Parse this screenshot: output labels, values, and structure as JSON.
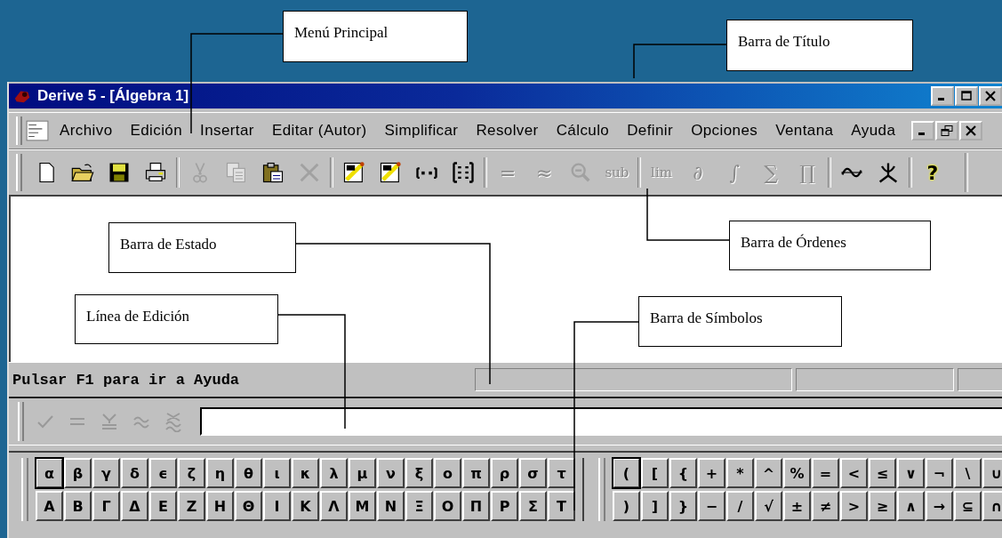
{
  "callouts": [
    {
      "text": "Menú Principal"
    },
    {
      "text": "Barra de Título"
    },
    {
      "text": "Barra de Estado"
    },
    {
      "text": "Barra de Órdenes"
    },
    {
      "text": "Línea de Edición"
    },
    {
      "text": "Barra de Símbolos"
    }
  ],
  "window": {
    "title": "Derive 5 - [Álgebra 1]"
  },
  "menu": [
    "Archivo",
    "Edición",
    "Insertar",
    "Editar (Autor)",
    "Simplificar",
    "Resolver",
    "Cálculo",
    "Definir",
    "Opciones",
    "Ventana",
    "Ayuda"
  ],
  "toolbar": [
    [
      {
        "kind": "page",
        "disabled": false
      },
      {
        "kind": "folder",
        "disabled": false
      },
      {
        "kind": "disk",
        "disabled": false
      },
      {
        "kind": "printer",
        "disabled": false
      }
    ],
    [
      {
        "kind": "scissors",
        "disabled": true
      },
      {
        "kind": "copy",
        "disabled": true
      },
      {
        "kind": "paste",
        "disabled": false
      },
      {
        "kind": "cross",
        "disabled": true
      }
    ],
    [
      {
        "kind": "author",
        "disabled": false
      },
      {
        "kind": "author",
        "disabled": false
      },
      {
        "kind": "vector",
        "disabled": false
      },
      {
        "kind": "matrix",
        "disabled": false
      }
    ],
    [
      {
        "kind": "glyph",
        "text": "=",
        "disabled": true
      },
      {
        "kind": "glyph",
        "text": "≈",
        "disabled": true
      },
      {
        "kind": "zoom",
        "disabled": true
      },
      {
        "kind": "glyph",
        "text": "sub",
        "disabled": true
      }
    ],
    [
      {
        "kind": "glyph",
        "text": "lim",
        "disabled": true
      },
      {
        "kind": "glyph",
        "text": "∂",
        "disabled": true
      },
      {
        "kind": "glyph",
        "text": "∫",
        "disabled": true
      },
      {
        "kind": "glyph",
        "text": "∑",
        "disabled": true
      },
      {
        "kind": "glyph",
        "text": "∏",
        "disabled": true
      }
    ],
    [
      {
        "kind": "plot2d",
        "disabled": false
      },
      {
        "kind": "plot3d",
        "disabled": false
      }
    ],
    [
      {
        "kind": "glyph",
        "text": "?",
        "disabled": false
      }
    ]
  ],
  "status_bar": {
    "text": "Pulsar F1 para ir a Ayuda"
  },
  "edit_line": {
    "buttons": [
      {
        "kind": "check",
        "disabled": true
      },
      {
        "kind": "equals",
        "disabled": true
      },
      {
        "kind": "approx-equals",
        "disabled": true
      },
      {
        "kind": "approx",
        "disabled": true
      },
      {
        "kind": "approx-cross",
        "disabled": true
      }
    ]
  },
  "symbols": [
    {
      "rows": [
        [
          {
            "text": "α",
            "selected": true
          },
          {
            "text": "β",
            "selected": false
          },
          {
            "text": "γ",
            "selected": false
          },
          {
            "text": "δ",
            "selected": false
          },
          {
            "text": "ϵ",
            "selected": false
          },
          {
            "text": "ζ",
            "selected": false
          },
          {
            "text": "η",
            "selected": false
          },
          {
            "text": "θ",
            "selected": false
          },
          {
            "text": "ι",
            "selected": false
          },
          {
            "text": "κ",
            "selected": false
          },
          {
            "text": "λ",
            "selected": false
          },
          {
            "text": "μ",
            "selected": false
          },
          {
            "text": "ν",
            "selected": false
          },
          {
            "text": "ξ",
            "selected": false
          },
          {
            "text": "ο",
            "selected": false
          },
          {
            "text": "π",
            "selected": false
          },
          {
            "text": "ρ",
            "selected": false
          },
          {
            "text": "σ",
            "selected": false
          },
          {
            "text": "τ",
            "selected": false
          }
        ],
        [
          {
            "text": "Α",
            "selected": false
          },
          {
            "text": "Β",
            "selected": false
          },
          {
            "text": "Γ",
            "selected": false
          },
          {
            "text": "Δ",
            "selected": false
          },
          {
            "text": "Ε",
            "selected": false
          },
          {
            "text": "Ζ",
            "selected": false
          },
          {
            "text": "Η",
            "selected": false
          },
          {
            "text": "Θ",
            "selected": false
          },
          {
            "text": "Ι",
            "selected": false
          },
          {
            "text": "Κ",
            "selected": false
          },
          {
            "text": "Λ",
            "selected": false
          },
          {
            "text": "Μ",
            "selected": false
          },
          {
            "text": "Ν",
            "selected": false
          },
          {
            "text": "Ξ",
            "selected": false
          },
          {
            "text": "Ο",
            "selected": false
          },
          {
            "text": "Π",
            "selected": false
          },
          {
            "text": "Ρ",
            "selected": false
          },
          {
            "text": "Σ",
            "selected": false
          },
          {
            "text": "Τ",
            "selected": false
          }
        ]
      ]
    },
    {
      "rows": [
        [
          {
            "text": "(",
            "selected": true
          },
          {
            "text": "[",
            "selected": false
          },
          {
            "text": "{",
            "selected": false
          },
          {
            "text": "+",
            "selected": false
          },
          {
            "text": "*",
            "selected": false
          },
          {
            "text": "^",
            "selected": false
          },
          {
            "text": "%",
            "selected": false
          },
          {
            "text": "=",
            "selected": false
          },
          {
            "text": "<",
            "selected": false
          },
          {
            "text": "≤",
            "selected": false
          },
          {
            "text": "∨",
            "selected": false
          },
          {
            "text": "¬",
            "selected": false
          },
          {
            "text": "\\",
            "selected": false
          },
          {
            "text": "∪",
            "selected": false
          }
        ],
        [
          {
            "text": ")",
            "selected": false
          },
          {
            "text": "]",
            "selected": false
          },
          {
            "text": "}",
            "selected": false
          },
          {
            "text": "−",
            "selected": false
          },
          {
            "text": "/",
            "selected": false
          },
          {
            "text": "√",
            "selected": false
          },
          {
            "text": "±",
            "selected": false
          },
          {
            "text": "≠",
            "selected": false
          },
          {
            "text": ">",
            "selected": false
          },
          {
            "text": "≥",
            "selected": false
          },
          {
            "text": "∧",
            "selected": false
          },
          {
            "text": "→",
            "selected": false
          },
          {
            "text": "⊆",
            "selected": false
          },
          {
            "text": "∩",
            "selected": false
          }
        ]
      ]
    }
  ]
}
